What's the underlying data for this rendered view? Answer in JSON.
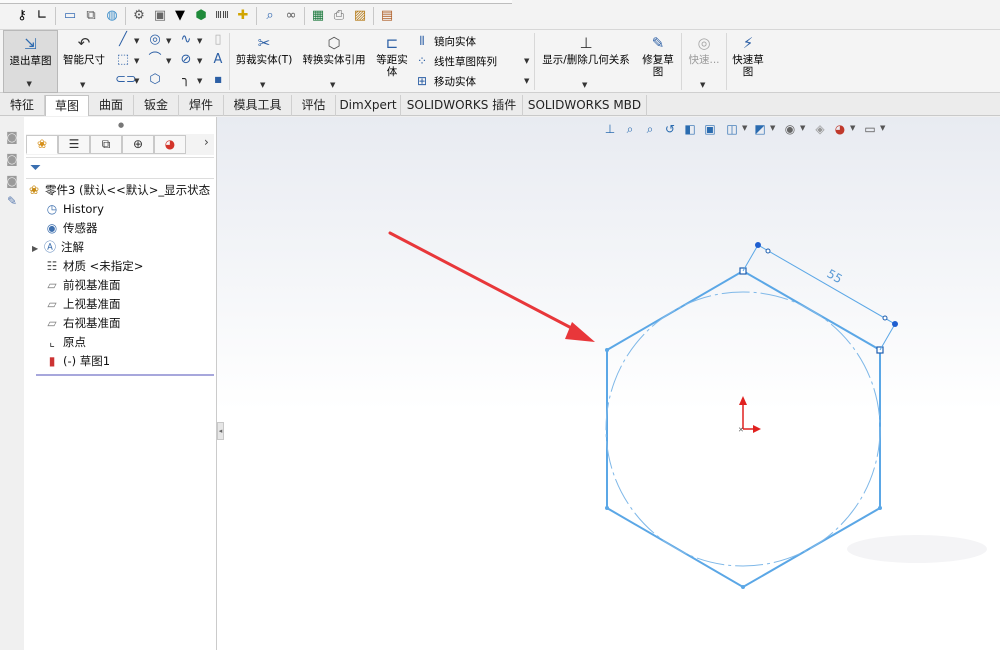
{
  "quick_access": {
    "icons": [
      "key-icon",
      "sketch-corner-icon",
      "monitor-icon",
      "assembly-icon",
      "globe-icon",
      "gear-icon",
      "box-icon",
      "cup-icon",
      "shield-green-icon",
      "ruler-icon",
      "plus-yellow-icon",
      "zoom-icon",
      "binoculars-icon",
      "excel-icon",
      "printer-icon",
      "image-edit-icon",
      "document-icon"
    ]
  },
  "command_manager": {
    "exit_sketch": "退出草图",
    "smart_dimension": "智能尺寸",
    "trim_entities": "剪裁实体(T)",
    "convert_entities": "转换实体引用",
    "offset_entities": "等距实体",
    "mirror_entities": "镜向实体",
    "linear_pattern": "线性草图阵列",
    "move_entities": "移动实体",
    "display_relations": "显示/删除几何关系",
    "repair_sketch": "修复草图",
    "quick_snaps": "快速...",
    "rapid_sketch": "快速草图"
  },
  "tabs": [
    {
      "label": "特征",
      "active": false
    },
    {
      "label": "草图",
      "active": true
    },
    {
      "label": "曲面",
      "active": false
    },
    {
      "label": "钣金",
      "active": false
    },
    {
      "label": "焊件",
      "active": false
    },
    {
      "label": "模具工具",
      "active": false
    },
    {
      "label": "评估",
      "active": false
    },
    {
      "label": "DimXpert",
      "active": false
    },
    {
      "label": "SOLIDWORKS 插件",
      "active": false
    },
    {
      "label": "SOLIDWORKS MBD",
      "active": false
    }
  ],
  "feature_tree": {
    "root": "零件3 (默认<<默认>_显示状态",
    "items": [
      {
        "label": "History",
        "icon": "history-icon"
      },
      {
        "label": "传感器",
        "icon": "sensor-icon"
      },
      {
        "label": "注解",
        "icon": "annotation-icon"
      },
      {
        "label": "材质 <未指定>",
        "icon": "material-icon"
      },
      {
        "label": "前视基准面",
        "icon": "plane-icon"
      },
      {
        "label": "上视基准面",
        "icon": "plane-icon"
      },
      {
        "label": "右视基准面",
        "icon": "plane-icon"
      },
      {
        "label": "原点",
        "icon": "origin-icon"
      },
      {
        "label": "(-) 草图1",
        "icon": "sketch-icon"
      }
    ]
  },
  "sketch": {
    "dimension": "55",
    "line_color": "#5ba7e6",
    "arrow_color": "#e8373a",
    "origin_color": "#e0211f"
  }
}
